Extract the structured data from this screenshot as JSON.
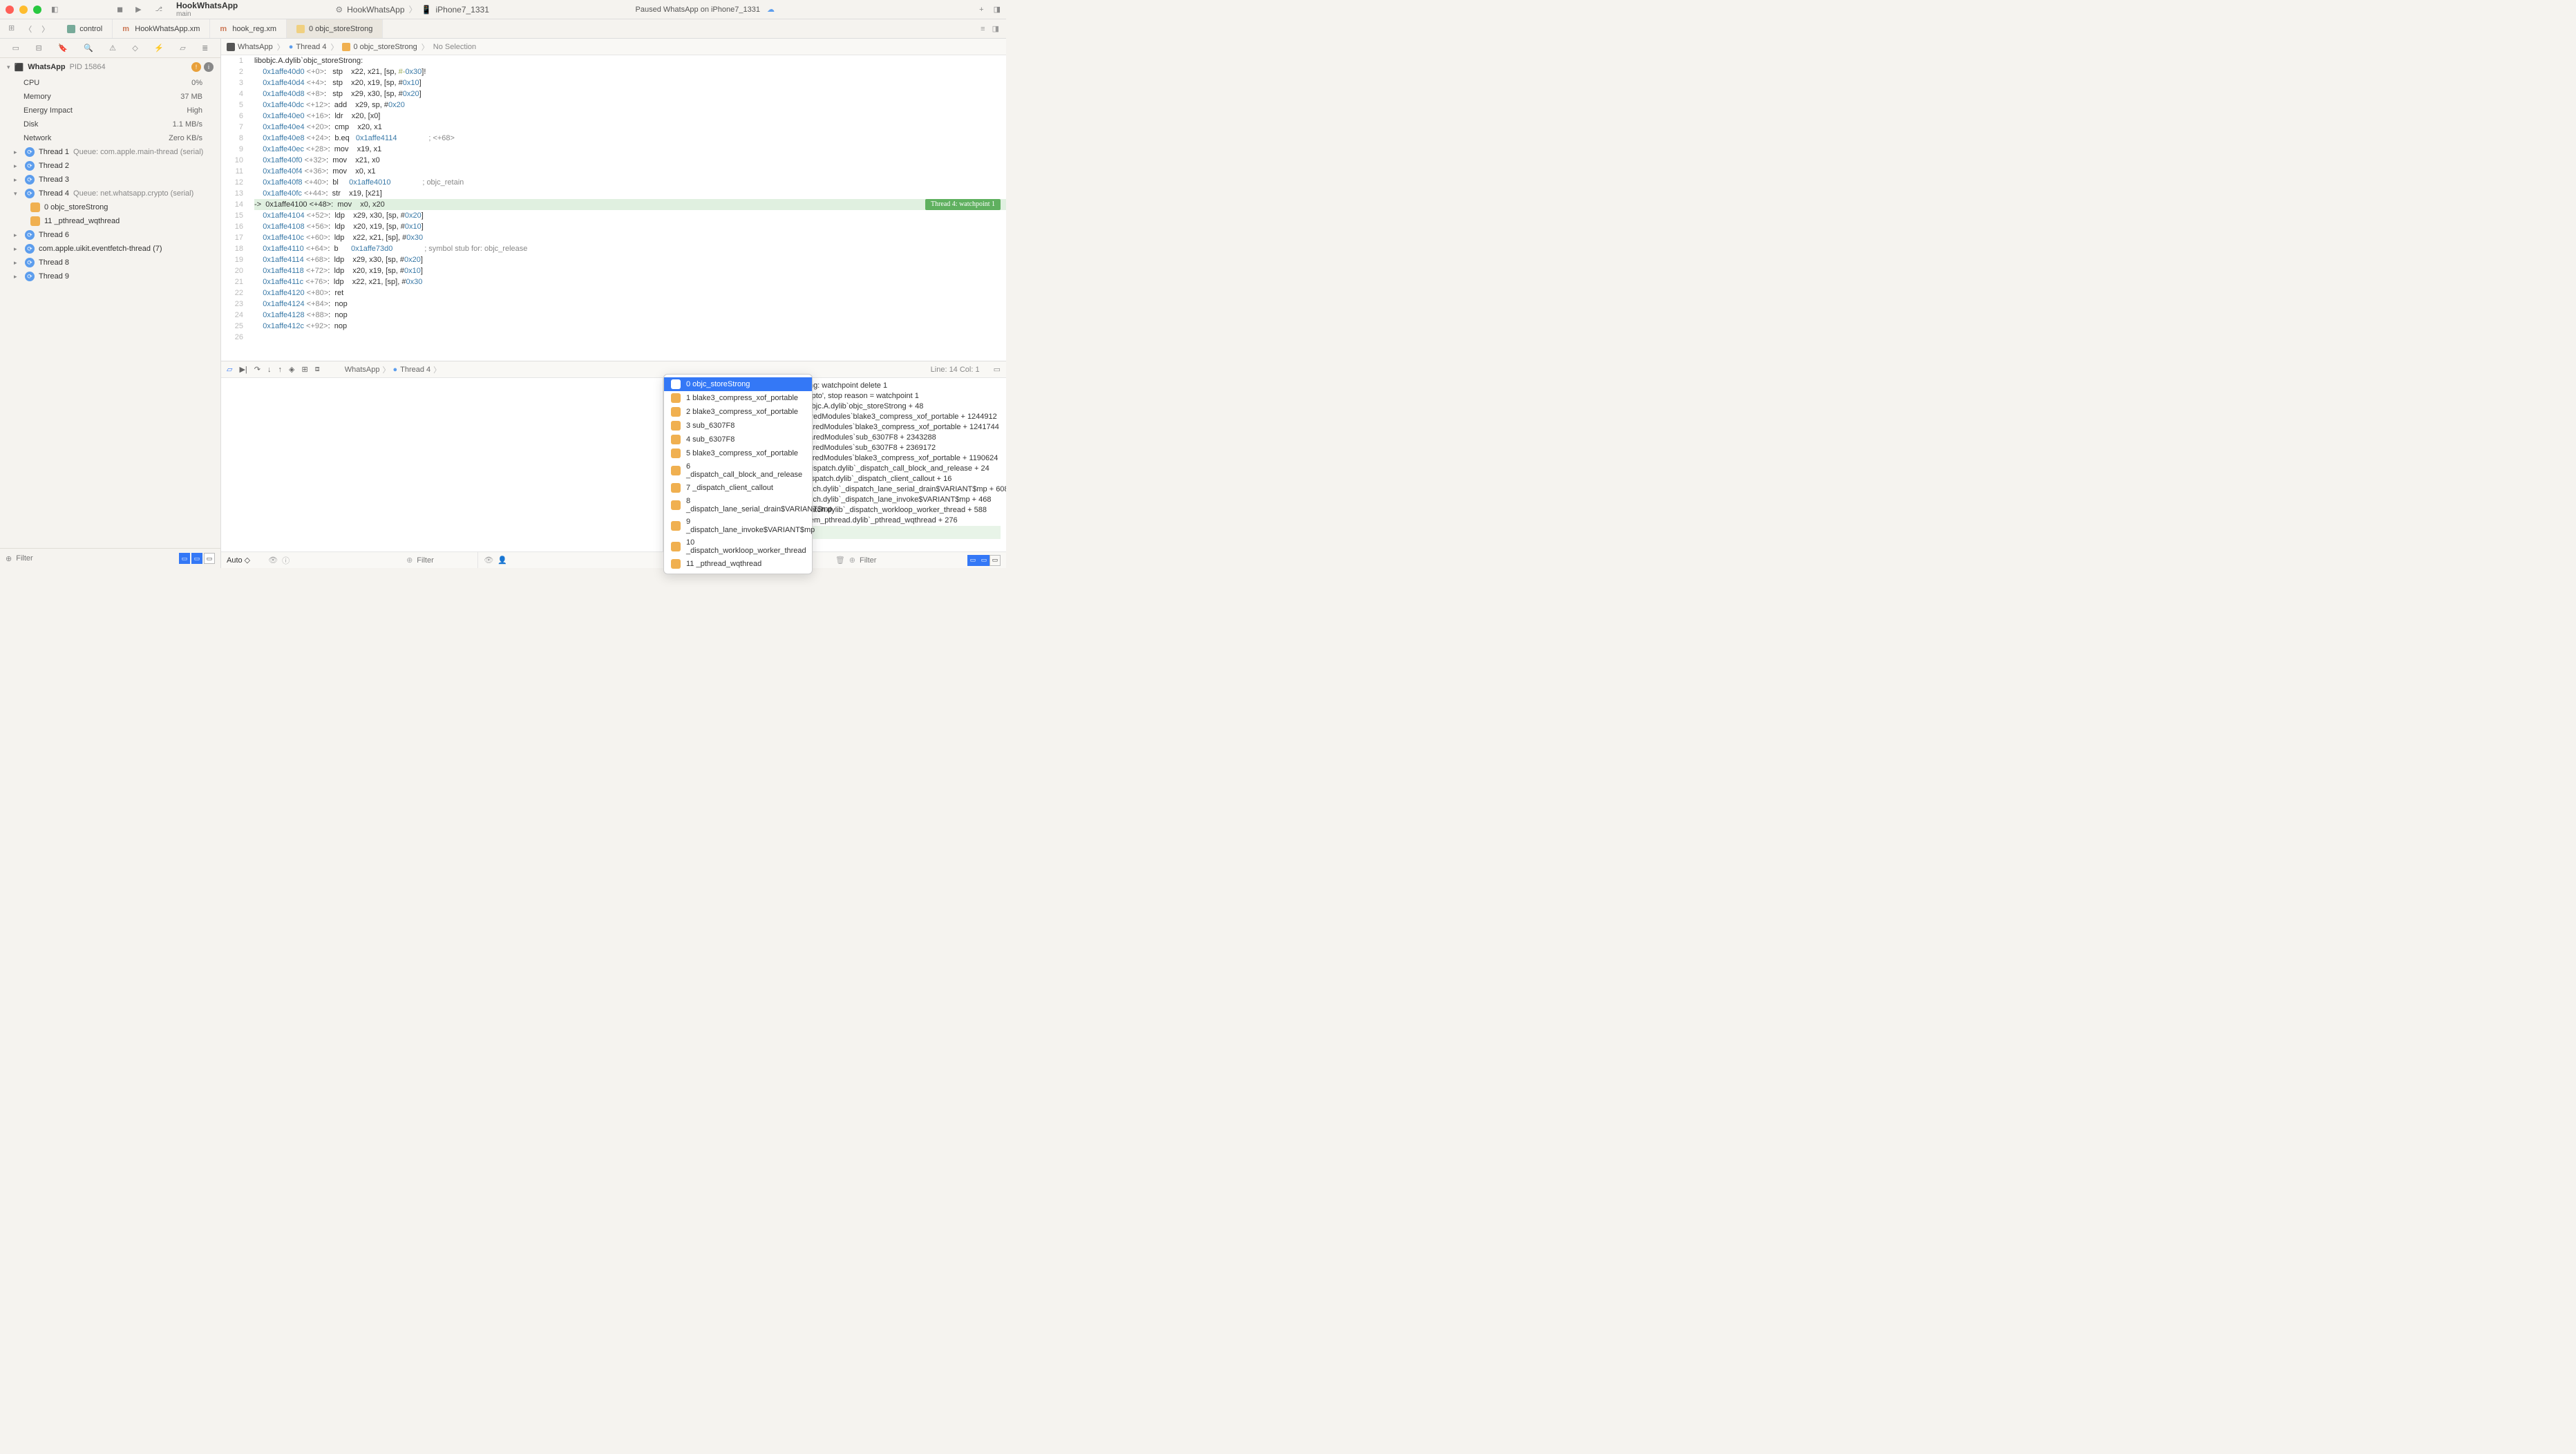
{
  "titlebar": {
    "project_name": "HookWhatsApp",
    "branch": "main",
    "scheme": "HookWhatsApp",
    "destination": "iPhone7_1331",
    "status": "Paused WhatsApp on iPhone7_1331"
  },
  "tabs": [
    {
      "label": "control",
      "type": "ctrl"
    },
    {
      "label": "HookWhatsApp.xm",
      "type": "m"
    },
    {
      "label": "hook_reg.xm",
      "type": "m"
    },
    {
      "label": "0 objc_storeStrong",
      "type": "asm",
      "active": true
    }
  ],
  "sidebar": {
    "process": {
      "name": "WhatsApp",
      "pid": "PID 15864"
    },
    "metrics": [
      {
        "label": "CPU",
        "value": "0%"
      },
      {
        "label": "Memory",
        "value": "37 MB"
      },
      {
        "label": "Energy Impact",
        "value": "High"
      },
      {
        "label": "Disk",
        "value": "1.1 MB/s"
      },
      {
        "label": "Network",
        "value": "Zero KB/s"
      }
    ],
    "threads": [
      {
        "name": "Thread 1",
        "queue": "Queue: com.apple.main-thread (serial)",
        "expanded": false
      },
      {
        "name": "Thread 2",
        "queue": "",
        "expanded": false
      },
      {
        "name": "Thread 3",
        "queue": "",
        "expanded": false
      },
      {
        "name": "Thread 4",
        "queue": "Queue: net.whatsapp.crypto (serial)",
        "expanded": true,
        "frames": [
          {
            "idx": "0",
            "name": "objc_storeStrong"
          },
          {
            "idx": "11",
            "name": "_pthread_wqthread"
          }
        ]
      },
      {
        "name": "Thread 6",
        "queue": "",
        "expanded": false
      },
      {
        "name": "com.apple.uikit.eventfetch-thread (7)",
        "queue": "",
        "expanded": false
      },
      {
        "name": "Thread 8",
        "queue": "",
        "expanded": false
      },
      {
        "name": "Thread 9",
        "queue": "",
        "expanded": false
      }
    ],
    "filter_placeholder": "Filter"
  },
  "jump_bar": {
    "items": [
      "WhatsApp",
      "Thread 4",
      "0 objc_storeStrong",
      "No Selection"
    ]
  },
  "editor": {
    "cursor": "Line: 14  Col: 1",
    "wp_label": "Thread 4: watchpoint 1",
    "lines": [
      "libobjc.A.dylib`objc_storeStrong:",
      "    0x1affe40d0 <+0>:   stp    x22, x21, [sp, #-0x30]!",
      "    0x1affe40d4 <+4>:   stp    x20, x19, [sp, #0x10]",
      "    0x1affe40d8 <+8>:   stp    x29, x30, [sp, #0x20]",
      "    0x1affe40dc <+12>:  add    x29, sp, #0x20",
      "    0x1affe40e0 <+16>:  ldr    x20, [x0]",
      "    0x1affe40e4 <+20>:  cmp    x20, x1",
      "    0x1affe40e8 <+24>:  b.eq   0x1affe4114               ; <+68>",
      "    0x1affe40ec <+28>:  mov    x19, x1",
      "    0x1affe40f0 <+32>:  mov    x21, x0",
      "    0x1affe40f4 <+36>:  mov    x0, x1",
      "    0x1affe40f8 <+40>:  bl     0x1affe4010               ; objc_retain",
      "    0x1affe40fc <+44>:  str    x19, [x21]",
      "->  0x1affe4100 <+48>:  mov    x0, x20",
      "    0x1affe4104 <+52>:  ldp    x29, x30, [sp, #0x20]",
      "    0x1affe4108 <+56>:  ldp    x20, x19, [sp, #0x10]",
      "    0x1affe410c <+60>:  ldp    x22, x21, [sp], #0x30",
      "    0x1affe4110 <+64>:  b      0x1affe73d0               ; symbol stub for: objc_release",
      "    0x1affe4114 <+68>:  ldp    x29, x30, [sp, #0x20]",
      "    0x1affe4118 <+72>:  ldp    x20, x19, [sp, #0x10]",
      "    0x1affe411c <+76>:  ldp    x22, x21, [sp], #0x30",
      "    0x1affe4120 <+80>:  ret    ",
      "    0x1affe4124 <+84>:  nop    ",
      "    0x1affe4128 <+88>:  nop    ",
      "    0x1affe412c <+92>:  nop    ",
      ""
    ]
  },
  "debug_bar": {
    "process_path": [
      "WhatsApp",
      "Thread 4"
    ]
  },
  "stack_popup": [
    "0 objc_storeStrong",
    "1 blake3_compress_xof_portable",
    "2 blake3_compress_xof_portable",
    "3 sub_6307F8",
    "4 sub_6307F8",
    "5 blake3_compress_xof_portable",
    "6 _dispatch_call_block_and_release",
    "7 _dispatch_client_callout",
    "8 _dispatch_lane_serial_drain$VARIANT$mp",
    "9 _dispatch_lane_invoke$VARIANT$mp",
    "10 _dispatch_workloop_worker_thread",
    "11 _pthread_wqthread"
  ],
  "console": [
    "                                                     point using: watchpoint delete 1",
    "",
    "",
    "                                                     tsapp.crypto', stop reason = watchpoint 1",
    "                                                     4100 libobjc.A.dylib`objc_storeStrong + 48",
    "                                                     5fdc SharedModules`blake3_compress_xof_portable + 1244912",
    "                                                     537c SharedModules`blake3_compress_xof_portable + 1241744",
    "                                                     3970 SharedModules`sub_6307F8 + 2343288",
    "                                                     ee8c SharedModules`sub_6307F8 + 2369172",
    "                                                     7bcc SharedModules`blake3_compress_xof_portable + 1190624",
    "                                                     e610 libdispatch.dylib`_dispatch_call_block_and_release + 24",
    "                                                     f184 libdispatch.dylib`_dispatch_client_callout + 16",
    "    frame #8: 0x00000001aff1b404 libdispatch.dylib`_dispatch_lane_serial_drain$VARIANT$mp + 608",
    "    frame #9: 0x00000001aff1be28 libdispatch.dylib`_dispatch_lane_invoke$VARIANT$mp + 468",
    "    frame #10: 0x00000001aff25314 libdispatch.dylib`_dispatch_workloop_worker_thread + 588",
    "    frame #11: 0x00000001affbeb88 libsystem_pthread.dylib`_pthread_wqthread + 276"
  ],
  "console_prompt": "(lldb) ",
  "footer": {
    "auto": "Auto ◇",
    "vars_filter": "Filter",
    "console_filter": "Filter"
  }
}
